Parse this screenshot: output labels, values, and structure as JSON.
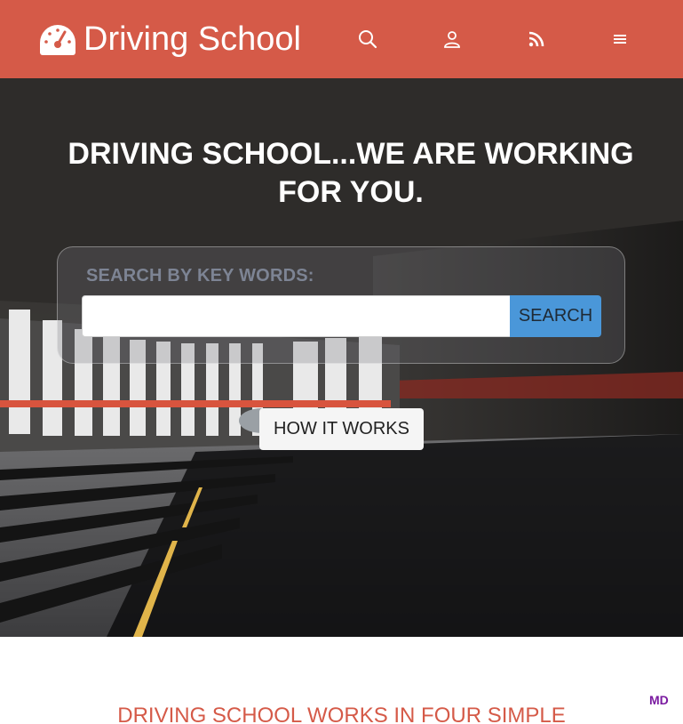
{
  "header": {
    "brand": "Driving School",
    "brand_icon": "speedometer-icon",
    "icons": [
      "search-icon",
      "user-icon",
      "rss-icon",
      "menu-icon"
    ],
    "color": "#d55a48"
  },
  "hero": {
    "title": "DRIVING SCHOOL...WE ARE WORKING FOR YOU.",
    "search": {
      "label": "SEARCH BY KEY WORDS:",
      "value": "",
      "placeholder": "",
      "button": "SEARCH"
    },
    "how_it_works": "HOW IT WORKS"
  },
  "section": {
    "title": "DRIVING SCHOOL WORKS IN FOUR SIMPLE"
  },
  "badge": "MD",
  "colors": {
    "accent": "#d55a48",
    "search_button": "#4a97d9",
    "label": "#7d8494",
    "badge": "#7a1aa0"
  }
}
